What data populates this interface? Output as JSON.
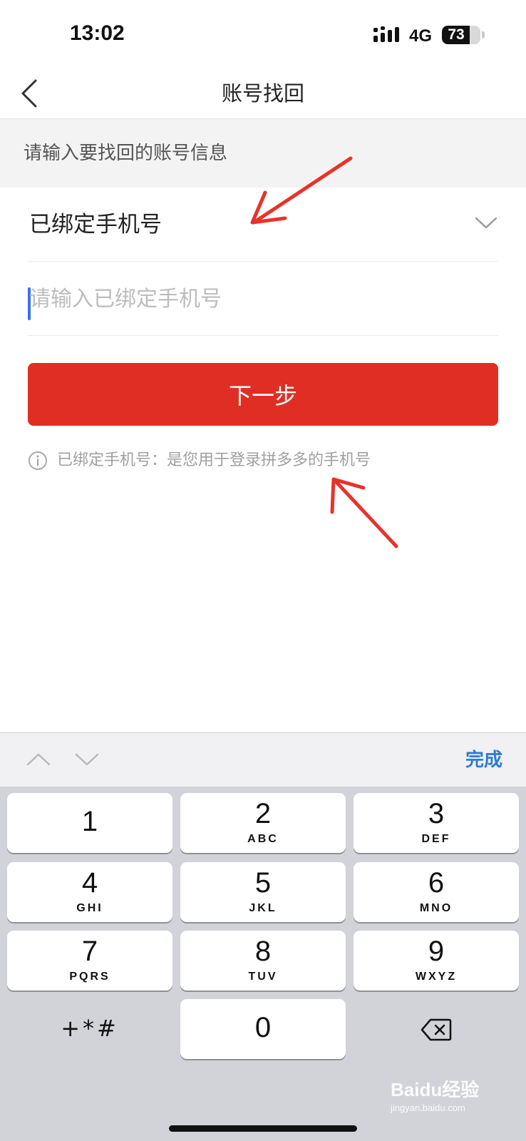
{
  "status_bar": {
    "time": "13:02",
    "network": "4G",
    "battery": "73",
    "battery_level": 0.73
  },
  "nav": {
    "title": "账号找回",
    "back_icon": "chevron-left-icon"
  },
  "section_header": "请输入要找回的账号信息",
  "form": {
    "account_type": "已绑定手机号",
    "phone_placeholder": "请输入已绑定手机号",
    "phone_value": "",
    "next_label": "下一步",
    "hint": "已绑定手机号：是您用于登录拼多多的手机号"
  },
  "keyboard_toolbar": {
    "done_label": "完成"
  },
  "keyboard": {
    "keys": [
      {
        "num": "1",
        "letters": ""
      },
      {
        "num": "2",
        "letters": "ABC"
      },
      {
        "num": "3",
        "letters": "DEF"
      },
      {
        "num": "4",
        "letters": "GHI"
      },
      {
        "num": "5",
        "letters": "JKL"
      },
      {
        "num": "6",
        "letters": "MNO"
      },
      {
        "num": "7",
        "letters": "PQRS"
      },
      {
        "num": "8",
        "letters": "TUV"
      },
      {
        "num": "9",
        "letters": "WXYZ"
      },
      {
        "num": "0",
        "letters": ""
      }
    ],
    "symbols_label": "+*#"
  },
  "watermark": {
    "brand": "Baidu经验",
    "url": "jingyan.baidu.com"
  },
  "colors": {
    "accent_red": "#e02e24",
    "annotation_red": "#e8322a",
    "done_blue": "#2d7bd8",
    "caret_blue": "#3a6ff0"
  }
}
